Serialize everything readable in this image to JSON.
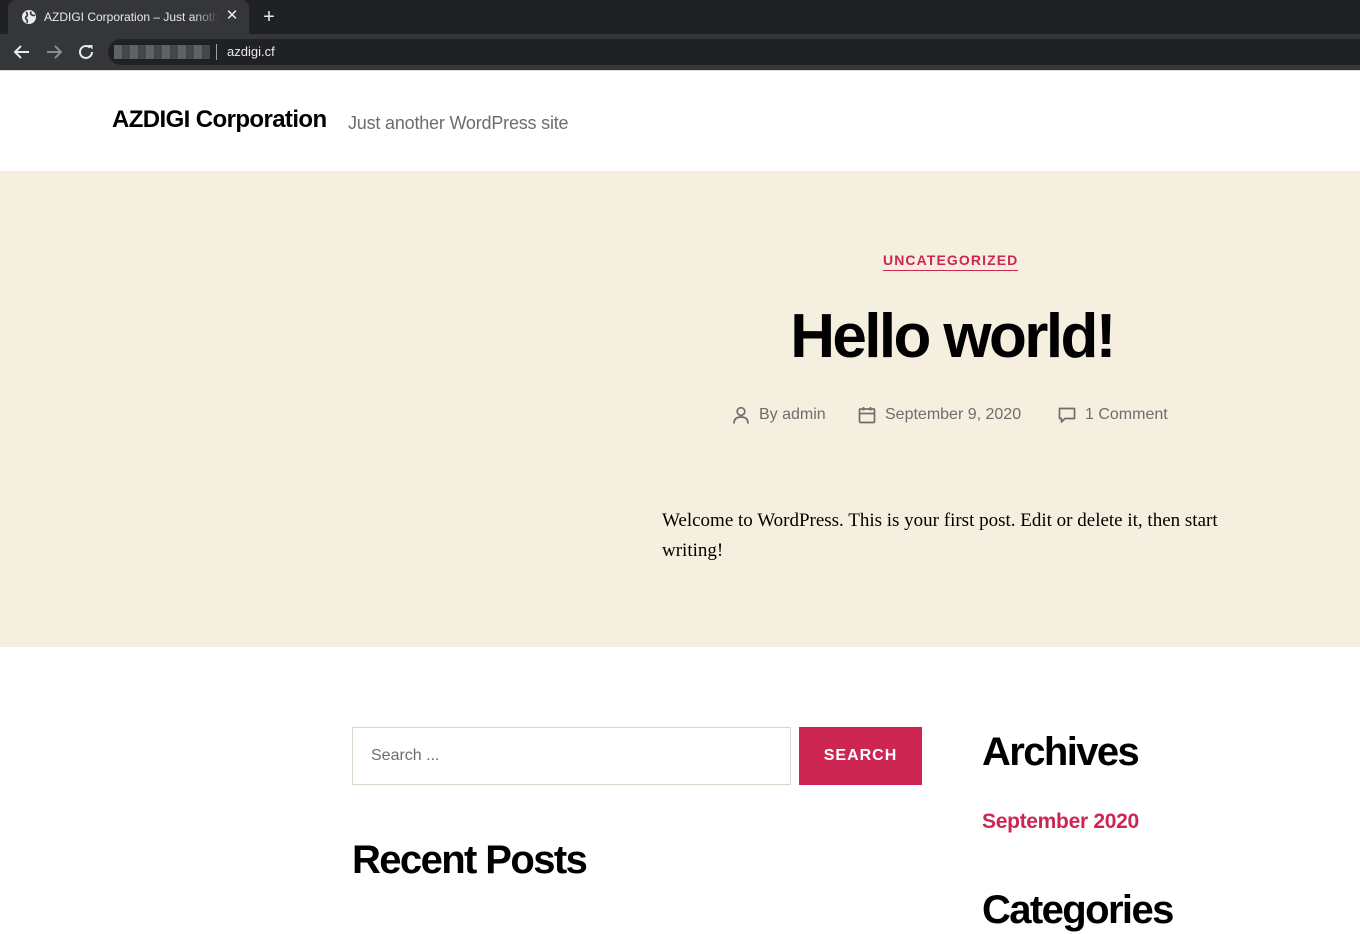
{
  "browser": {
    "tab_title": "AZDIGI Corporation – Just another WordPress site",
    "url": "azdigi.cf",
    "new_tab_icon": "plus-icon",
    "close_icon": "close-icon"
  },
  "site": {
    "title": "AZDIGI Corporation",
    "description": "Just another WordPress site"
  },
  "post": {
    "category": "UNCATEGORIZED",
    "title": "Hello world!",
    "author": "By admin",
    "date": "September 9, 2020",
    "comments": "1 Comment",
    "body": "Welcome to WordPress. This is your first post. Edit or delete it, then start writing!"
  },
  "widgets": {
    "search_placeholder": "Search ...",
    "search_button": "SEARCH",
    "recent_posts_heading": "Recent Posts",
    "archives_heading": "Archives",
    "archive_links": [
      "September 2020"
    ],
    "categories_heading": "Categories"
  },
  "colors": {
    "accent": "#cd2653",
    "hero_bg": "#f5efe0",
    "chrome_dark": "#202124",
    "chrome_tab": "#35363a"
  }
}
